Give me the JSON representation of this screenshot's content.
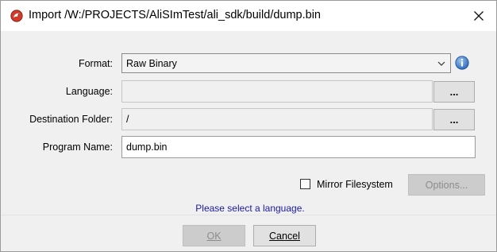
{
  "window": {
    "title": "Import /W:/PROJECTS/AliSImTest/ali_sdk/build/dump.bin",
    "app_icon": "dragon-icon",
    "close_icon": "close-icon"
  },
  "form": {
    "format": {
      "label": "Format:",
      "value": "Raw Binary",
      "info_icon": "info-icon"
    },
    "language": {
      "label": "Language:",
      "value": "",
      "browse_label": "..."
    },
    "destination": {
      "label": "Destination Folder:",
      "value": "/",
      "browse_label": "..."
    },
    "program_name": {
      "label": "Program Name:",
      "value": "dump.bin"
    }
  },
  "mirror": {
    "label": "Mirror Filesystem",
    "checked": false
  },
  "options_button": {
    "label": "Options...",
    "enabled": false
  },
  "status_message": "Please select a language.",
  "footer": {
    "ok_label": "OK",
    "ok_enabled": false,
    "cancel_label": "Cancel"
  },
  "colors": {
    "status_text": "#1a1aa8",
    "info_icon": "#3b78c8",
    "app_icon": "#d23a2a"
  }
}
